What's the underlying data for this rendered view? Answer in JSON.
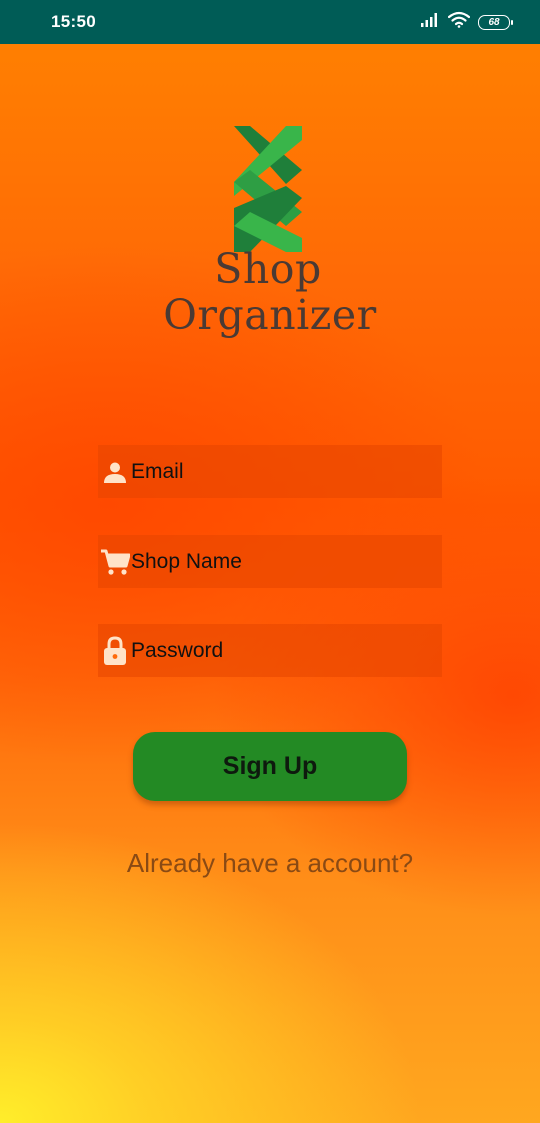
{
  "status_bar": {
    "time": "15:50",
    "battery": "68",
    "icons": [
      "signal-icon",
      "wifi-icon",
      "battery-icon"
    ]
  },
  "logo": {
    "line1": "Shop",
    "line2": "Organizer"
  },
  "form": {
    "email_label": "Email",
    "shop_name_label": "Shop Name",
    "password_label": "Password"
  },
  "actions": {
    "signup_label": "Sign Up",
    "login_link": "Already have a account?"
  },
  "colors": {
    "status_bar": "#005c56",
    "button": "#238a24",
    "logo_text": "#4a3a34",
    "logo_green_dark": "#1f7f3a",
    "logo_green_light": "#39b54a",
    "link_text": "#8a4a14"
  }
}
